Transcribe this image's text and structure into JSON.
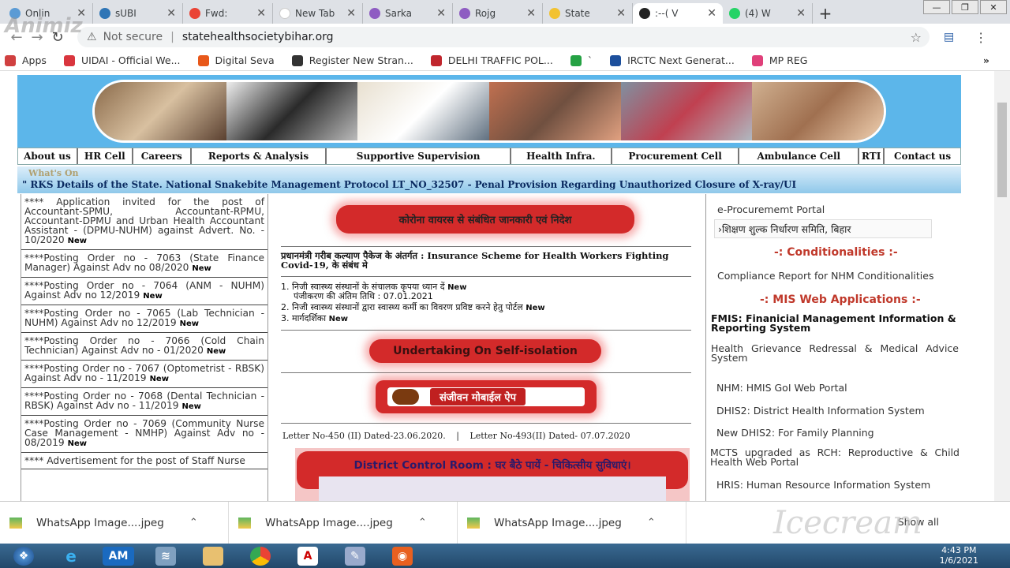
{
  "tabs": [
    {
      "label": "Onlin",
      "color": "#5b9bd5"
    },
    {
      "label": "sUBI",
      "color": "#2e75b6"
    },
    {
      "label": "Fwd:",
      "color": "#ea4335"
    },
    {
      "label": "New Tab",
      "color": "#ffffff"
    },
    {
      "label": "Sarka",
      "color": "#8e5cc2"
    },
    {
      "label": "Rojg",
      "color": "#8e5cc2"
    },
    {
      "label": "State",
      "color": "#f2c230"
    },
    {
      "label": ":--( V",
      "color": "#222222"
    },
    {
      "label": "(4) W",
      "color": "#25d366"
    }
  ],
  "address": {
    "security": "Not secure",
    "separator": "|",
    "url": "statehealthsocietybihar.org"
  },
  "bookmarks": [
    {
      "label": "Apps",
      "color": "#d04040"
    },
    {
      "label": "UIDAI - Official We...",
      "color": "#d9363e"
    },
    {
      "label": "Digital Seva",
      "color": "#e8581a"
    },
    {
      "label": "Register New Stran...",
      "color": "#333333"
    },
    {
      "label": "DELHI TRAFFIC POL...",
      "color": "#c0262d"
    },
    {
      "label": "`",
      "color": "#25a244"
    },
    {
      "label": "IRCTC Next Generat...",
      "color": "#1c4f9c"
    },
    {
      "label": "MP REG",
      "color": "#e0407a"
    }
  ],
  "menu": [
    "About us",
    "HR Cell",
    "Careers",
    "Reports & Analysis",
    "Supportive Supervision",
    "Health Infra.",
    "Procurement Cell",
    "Ambulance Cell",
    "RTI",
    "Contact us"
  ],
  "whats_on": {
    "label": "What's On",
    "ticker": "\"        RKS Details of the State.     National Snakebite Management Protocol     LT_NO_32507 - Penal Provision Regarding Unauthorized Closure of X-ray/UI"
  },
  "left_items": [
    {
      "text": "**** Application invited for the post of Accountant-SPMU, Accountant-RPMU, Accountant-DPMU and Urban Health Accountant Assistant - (DPMU-NUHM) against Advert. No. - 10/2020",
      "badge": "New"
    },
    {
      "text": "****Posting Order no - 7063 (State Finance Manager) Against Adv no 08/2020",
      "badge": "New"
    },
    {
      "text": "****Posting Order no - 7064 (ANM - NUHM) Against Adv no 12/2019",
      "badge": "New"
    },
    {
      "text": "****Posting Order no - 7065 (Lab Technician - NUHM) Against Adv no 12/2019",
      "badge": "New"
    },
    {
      "text": "****Posting Order no - 7066 (Cold Chain Technician) Against Adv no - 01/2020",
      "badge": "New"
    },
    {
      "text": "****Posting Order no - 7067 (Optometrist - RBSK) Against Adv no - 11/2019",
      "badge": "New"
    },
    {
      "text": "****Posting Order no - 7068 (Dental Technician - RBSK) Against Adv no - 11/2019",
      "badge": "New"
    },
    {
      "text": "****Posting Order no - 7069 (Community Nurse Case Management - NMHP) Against Adv no - 08/2019",
      "badge": "New"
    },
    {
      "text": "**** Advertisement for the post of Staff Nurse",
      "badge": ""
    }
  ],
  "center": {
    "corona_button": "कोरोना वायरस से संबंधित जानकारी एवं निदेश",
    "pmgkp_text": "प्रधानमंत्री गरीब कल्याण पैकेज के अंतर्गत : Insurance Scheme for Health Workers Fighting Covid-19, के संबंध मे",
    "item1": "1. निजी स्वास्थ्य संस्थानों के संचालक कृपया ध्यान दें",
    "item1_sub": "पंजीकरण की अंतिम तिथि : 07.01.2021",
    "item2": "2. निजी स्वास्थ्य संस्थानों द्वारा स्वास्थ्य कर्मी का विवरण प्रविष्ट करने हेतु पोर्टल",
    "item3": "3. मार्गदर्शिका",
    "new": "New",
    "undertaking_button": "Undertaking On Self-isolation",
    "sanjeevan_button": "संजीवन मोबाईल ऐप",
    "letter1": "Letter No-450 (II) Dated-23.06.2020.",
    "letter_sep": "|",
    "letter2": "Letter No-493(II) Dated- 07.07.2020",
    "control_room": "District Control Room : घर बैठे पायें - चिकित्सीय सुविधाएं।"
  },
  "right": {
    "eproc": "e-Procurememt Portal",
    "fee": "›शिक्षण शुल्क निर्धारण समिति, बिहार",
    "cond_head": "-: Conditionalities :-",
    "compliance": "Compliance Report for NHM Conditionalities",
    "mis_head": "-: MIS Web Applications :-",
    "fmis": "FMIS: Finanicial Management Information & Reporting System",
    "health_grievance": "Health Grievance Redressal & Medical Advice System",
    "hmis": "NHM: HMIS GoI Web Portal",
    "dhis2": "DHIS2: District Health Information System",
    "new_dhis2": "New DHIS2: For Family Planning",
    "mcts": "MCTS upgraded as RCH: Reproductive & Child Health Web Portal",
    "hris": "HRIS: Human Resource Information System"
  },
  "downloads": [
    {
      "label": "WhatsApp Image....jpeg"
    },
    {
      "label": "WhatsApp Image....jpeg"
    },
    {
      "label": "WhatsApp Image....jpeg"
    }
  ],
  "show_all": "Show all",
  "taskbar": {
    "am": "AM",
    "time": "4:43 PM",
    "date": "1/6/2021"
  },
  "watermarks": {
    "top": "Animiz",
    "bottom": "Icecream"
  }
}
